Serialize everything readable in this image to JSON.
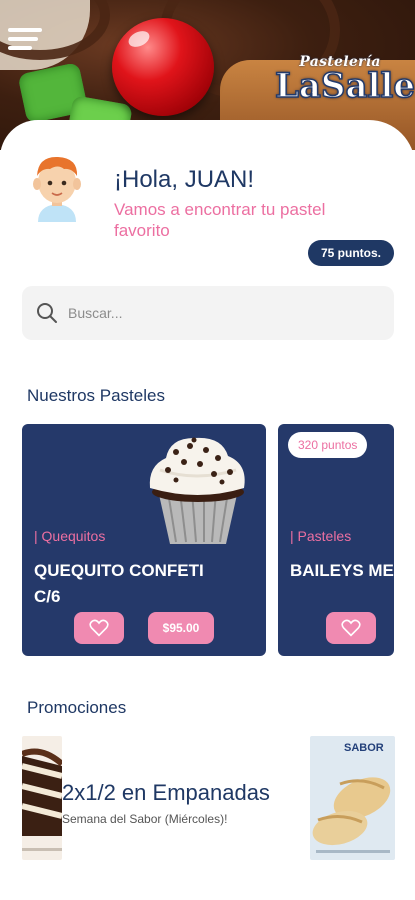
{
  "header": {
    "brand_small": "Pastelería",
    "brand_big": "LaSalle"
  },
  "greeting": {
    "title": "¡Hola, JUAN!",
    "subtitle": "Vamos a encontrar tu pastel favorito",
    "points": "75 puntos."
  },
  "search": {
    "placeholder": "Buscar..."
  },
  "sections": {
    "cakes_title": "Nuestros Pasteles",
    "promos_title": "Promociones"
  },
  "products": [
    {
      "category": "| Quequitos",
      "name_line1": "QUEQUITO CONFETI",
      "name_line2": "C/6",
      "price": "$95.00"
    },
    {
      "category": "| Pasteles",
      "name_line1": "BAILEYS ME",
      "points_badge": "320 puntos"
    }
  ],
  "promotion": {
    "title": "2x1/2 en Empanadas",
    "subtitle": "Semana del Sabor (Miércoles)!",
    "image_label": "SABOR"
  },
  "icons": {
    "menu": "hamburger-menu-icon",
    "search": "search-icon",
    "favorite": "heart-icon"
  },
  "colors": {
    "navy": "#1f3864",
    "card": "#25396a",
    "pink": "#ec6fa1",
    "pink_button": "#f08ab1"
  }
}
